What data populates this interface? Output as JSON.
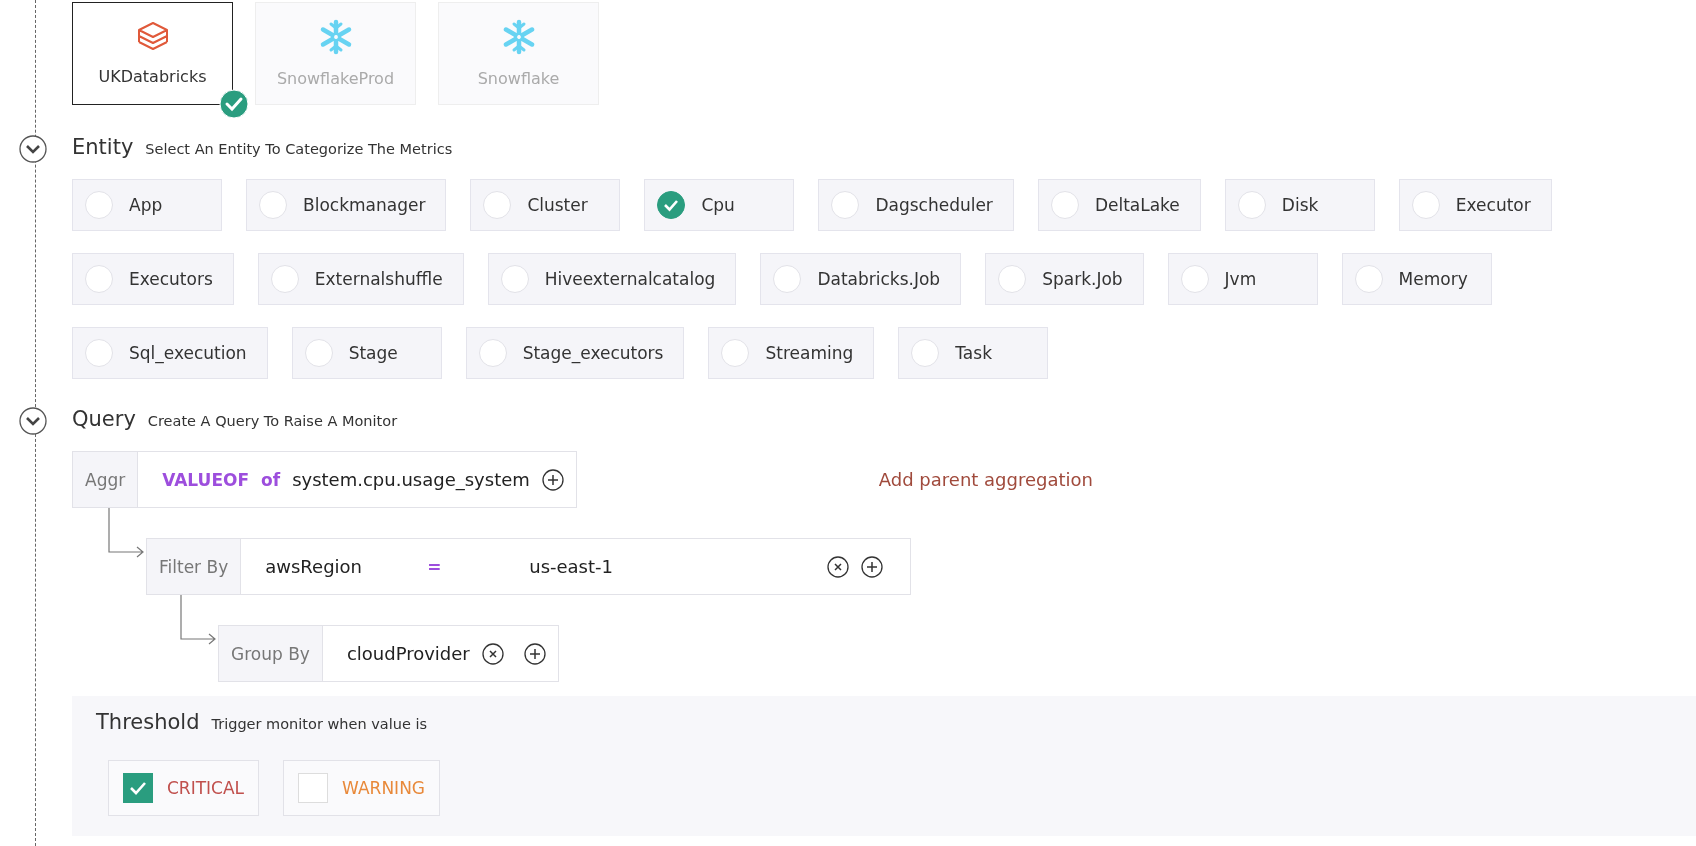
{
  "sources": [
    {
      "label": "UKDatabricks",
      "kind": "databricks",
      "selected": true
    },
    {
      "label": "SnowflakeProd",
      "kind": "snowflake",
      "selected": false
    },
    {
      "label": "Snowflake",
      "kind": "snowflake",
      "selected": false
    }
  ],
  "entity": {
    "title": "Entity",
    "subtitle": "Select An Entity To Categorize The Metrics",
    "items": [
      {
        "label": "App",
        "selected": false
      },
      {
        "label": "Blockmanager",
        "selected": false
      },
      {
        "label": "Cluster",
        "selected": false
      },
      {
        "label": "Cpu",
        "selected": true
      },
      {
        "label": "Dagscheduler",
        "selected": false
      },
      {
        "label": "DeltaLake",
        "selected": false
      },
      {
        "label": "Disk",
        "selected": false
      },
      {
        "label": "Executor",
        "selected": false
      },
      {
        "label": "Executors",
        "selected": false
      },
      {
        "label": "Externalshuffle",
        "selected": false
      },
      {
        "label": "Hiveexternalcatalog",
        "selected": false
      },
      {
        "label": "Databricks.Job",
        "selected": false
      },
      {
        "label": "Spark.Job",
        "selected": false
      },
      {
        "label": "Jvm",
        "selected": false
      },
      {
        "label": "Memory",
        "selected": false
      },
      {
        "label": "Sql_execution",
        "selected": false
      },
      {
        "label": "Stage",
        "selected": false
      },
      {
        "label": "Stage_executors",
        "selected": false
      },
      {
        "label": "Streaming",
        "selected": false
      },
      {
        "label": "Task",
        "selected": false
      }
    ]
  },
  "query": {
    "title": "Query",
    "subtitle": "Create A Query To Raise A Monitor",
    "aggr": {
      "label": "Aggr",
      "function": "VALUEOF",
      "joiner": "of",
      "metric": "system.cpu.usage_system"
    },
    "add_parent": "Add parent aggregation",
    "filter": {
      "label": "Filter By",
      "key": "awsRegion",
      "operator": "=",
      "value": "us-east-1"
    },
    "group": {
      "label": "Group By",
      "value": "cloudProvider"
    }
  },
  "threshold": {
    "title": "Threshold",
    "subtitle": "Trigger monitor when value is",
    "options": [
      {
        "label": "CRITICAL",
        "checked": true,
        "color": "#c0504d"
      },
      {
        "label": "WARNING",
        "checked": false,
        "color": "#e8893a"
      }
    ]
  }
}
